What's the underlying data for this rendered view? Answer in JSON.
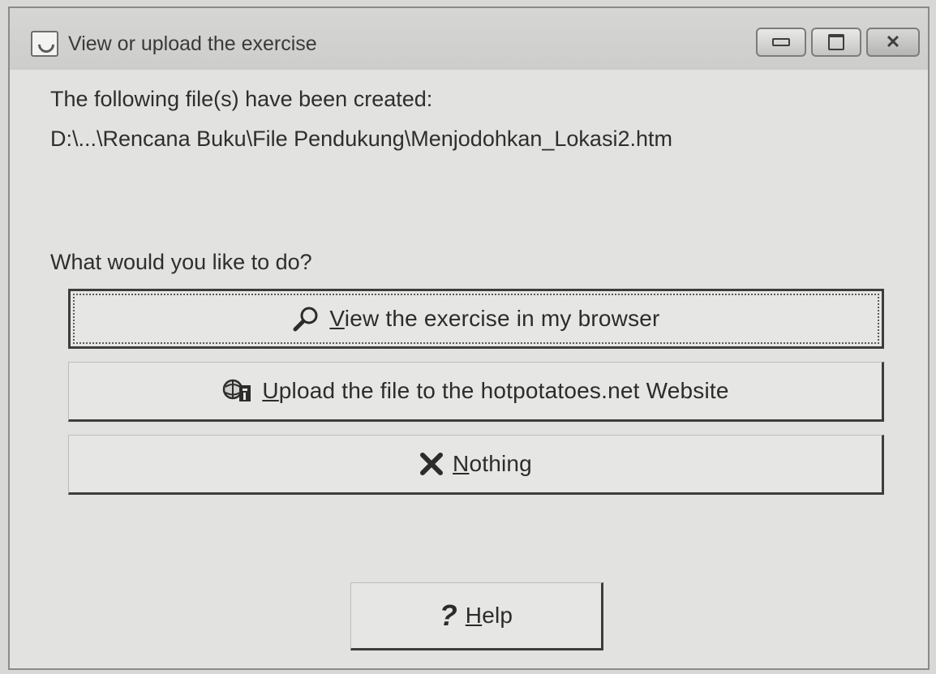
{
  "window": {
    "title": "View or upload the exercise",
    "controls": {
      "minimize_icon": "minimize-icon",
      "maximize_icon": "maximize-icon",
      "close_icon": "close-icon"
    }
  },
  "message": {
    "line1": "The following file(s) have been created:",
    "line2": "D:\\...\\Rencana Buku\\File Pendukung\\Menjodohkan_Lokasi2.htm",
    "question": "What would you like to do?"
  },
  "buttons": {
    "view": {
      "mnemonic": "V",
      "rest": "iew the exercise in my browser",
      "icon": "magnifier-icon"
    },
    "upload": {
      "mnemonic": "U",
      "rest": "pload the file to the hotpotatoes.net Website",
      "icon": "upload-icon"
    },
    "nothing": {
      "mnemonic": "N",
      "rest": "othing",
      "icon": "cross-icon"
    },
    "help": {
      "mnemonic": "H",
      "rest": "elp",
      "icon": "question-icon"
    }
  }
}
